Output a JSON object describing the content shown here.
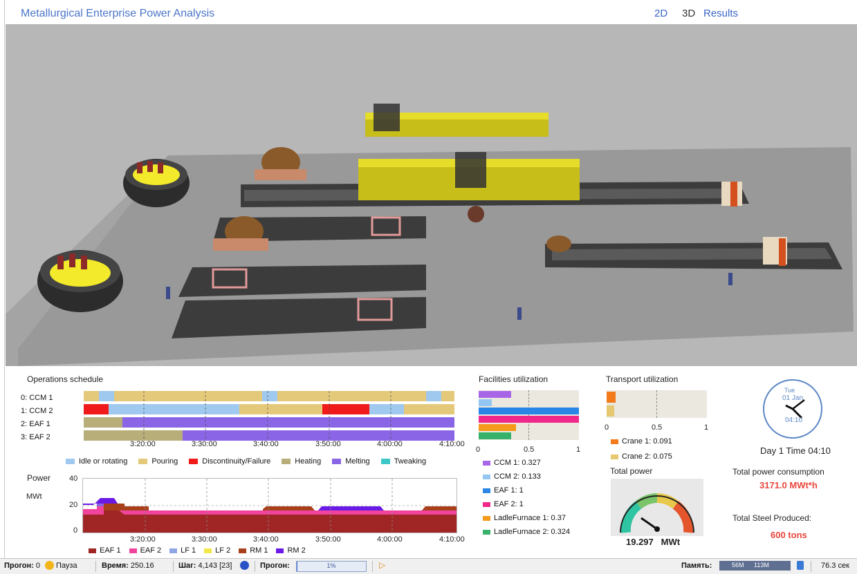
{
  "header": {
    "title": "Metallurgical Enterprise Power Analysis",
    "nav": [
      "2D",
      "3D",
      "Results"
    ]
  },
  "schedule": {
    "title": "Operations schedule",
    "rows": [
      "0:  CCM 1",
      "1:  CCM 2",
      "2:  EAF 1",
      "3:  EAF 2"
    ],
    "time_ticks": [
      "3:20:00",
      "3:30:00",
      "3:40:00",
      "3:50:00",
      "4:00:00",
      "4:10:00"
    ],
    "legend": [
      {
        "label": "Idle or rotating",
        "color": "#9fc9ef"
      },
      {
        "label": "Pouring",
        "color": "#e5c97a"
      },
      {
        "label": "Discontinuity/Failure",
        "color": "#f01a1a"
      },
      {
        "label": "Heating",
        "color": "#b8ae7a"
      },
      {
        "label": "Melting",
        "color": "#8a66e6"
      },
      {
        "label": "Tweaking",
        "color": "#3dc7c7"
      }
    ]
  },
  "power_chart": {
    "title": "Power",
    "unit": "MWt",
    "y_ticks": [
      "40",
      "20",
      "0"
    ],
    "x_ticks": [
      "3:20:00",
      "3:30:00",
      "3:40:00",
      "3:50:00",
      "4:00:00",
      "4:10:00"
    ],
    "legend": [
      {
        "label": "EAF 1",
        "color": "#a02626"
      },
      {
        "label": "EAF 2",
        "color": "#f0449c"
      },
      {
        "label": "LF 1",
        "color": "#8fa6e6"
      },
      {
        "label": "LF 2",
        "color": "#f2e84a"
      },
      {
        "label": "RM 1",
        "color": "#a8401c"
      },
      {
        "label": "RM 2",
        "color": "#6a1ae6"
      }
    ]
  },
  "facilities": {
    "title": "Facilities utilization",
    "ticks": [
      "0",
      "0.5",
      "1"
    ],
    "items": [
      {
        "label": "CCM 1: 0.327",
        "value": 0.327,
        "color": "#a866e6"
      },
      {
        "label": "CCM 2: 0.133",
        "value": 0.133,
        "color": "#93c6f2"
      },
      {
        "label": "EAF 1: 1",
        "value": 1,
        "color": "#2a86e6"
      },
      {
        "label": "EAF 2: 1",
        "value": 1,
        "color": "#f0288a"
      },
      {
        "label": "LadleFurnace 1: 0.37",
        "value": 0.37,
        "color": "#f59a1a"
      },
      {
        "label": "LadleFurnace 2: 0.324",
        "value": 0.324,
        "color": "#36b26a"
      }
    ]
  },
  "transport": {
    "title": "Transport utilization",
    "ticks": [
      "0",
      "0.5",
      "1"
    ],
    "items": [
      {
        "label": "Crane 1: 0.091",
        "value": 0.091,
        "color": "#f27a1a"
      },
      {
        "label": "Crane 2: 0.075",
        "value": 0.075,
        "color": "#e6c870"
      }
    ]
  },
  "total_power": {
    "title": "Total power",
    "value": "19.297",
    "unit": "MWt"
  },
  "clock": {
    "day": "Tue",
    "date": "01 Jan",
    "time": "04:10",
    "caption": "Day 1 Time 04:10"
  },
  "consumption": {
    "title": "Total power consumption",
    "value": "3171.0 MWt*h"
  },
  "steel": {
    "title": "Total Steel Produced:",
    "value": "600 tons"
  },
  "status": {
    "run_label": "Прогон:",
    "run_value": "0",
    "pause": "Пауза",
    "time_label": "Время:",
    "time_value": "250.16",
    "step_label": "Шаг:",
    "step_value": "4,143 [23]",
    "progress_label": "Прогон:",
    "progress_value": "1%",
    "progress_fraction": 0.01,
    "memory_label": "Память:",
    "memory_used": "56M",
    "memory_total": "113M",
    "fps": "76.3 сек"
  },
  "colors": {
    "accent": "#4a74c9",
    "highlight": "#e8453c"
  }
}
